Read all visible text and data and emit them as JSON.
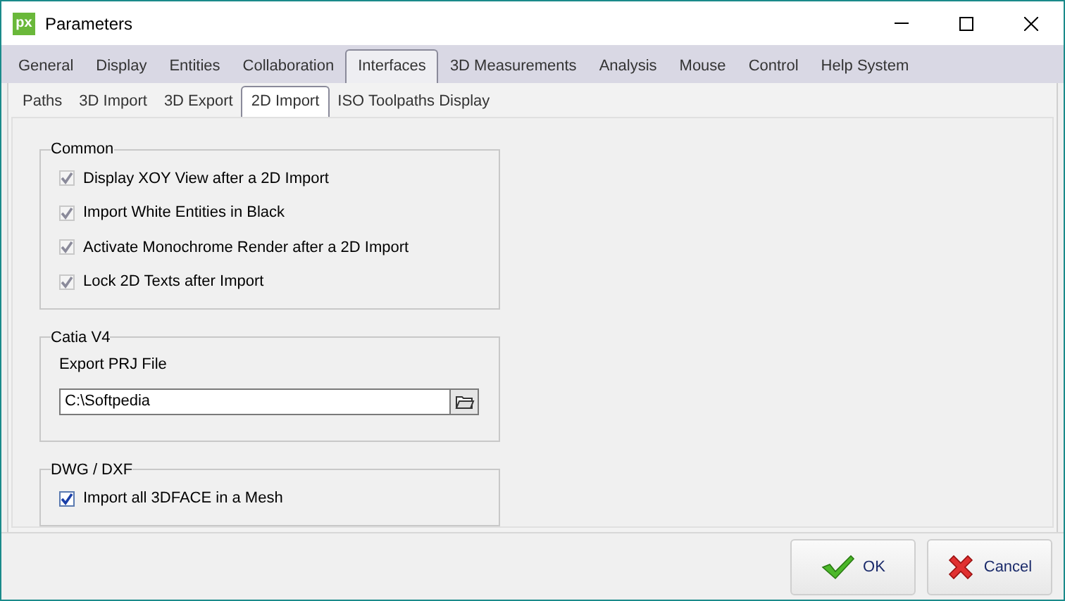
{
  "window": {
    "title": "Parameters",
    "logo": "px"
  },
  "tabs": [
    {
      "label": "General",
      "selected": false
    },
    {
      "label": "Display",
      "selected": false
    },
    {
      "label": "Entities",
      "selected": false
    },
    {
      "label": "Collaboration",
      "selected": false
    },
    {
      "label": "Interfaces",
      "selected": true
    },
    {
      "label": "3D Measurements",
      "selected": false
    },
    {
      "label": "Analysis",
      "selected": false
    },
    {
      "label": "Mouse",
      "selected": false
    },
    {
      "label": "Control",
      "selected": false
    },
    {
      "label": "Help System",
      "selected": false
    }
  ],
  "subtabs": [
    {
      "label": "Paths",
      "selected": false
    },
    {
      "label": "3D Import",
      "selected": false
    },
    {
      "label": "3D Export",
      "selected": false
    },
    {
      "label": "2D Import",
      "selected": true
    },
    {
      "label": "ISO Toolpaths Display",
      "selected": false
    }
  ],
  "groups": [
    {
      "title": "Common",
      "items": [
        {
          "kind": "checkbox",
          "label": "Display XOY View after a 2D Import",
          "checked": true,
          "disabled": true
        },
        {
          "kind": "checkbox",
          "label": "Import White Entities in Black",
          "checked": true,
          "disabled": true
        },
        {
          "kind": "checkbox",
          "label": "Activate Monochrome Render after a 2D Import",
          "checked": true,
          "disabled": true
        },
        {
          "kind": "checkbox",
          "label": "Lock 2D Texts after Import",
          "checked": true,
          "disabled": true
        }
      ]
    },
    {
      "title": "Catia V4",
      "items": [
        {
          "kind": "file",
          "label": "Export PRJ File",
          "value": "C:\\Softpedia"
        }
      ]
    },
    {
      "title": "DWG / DXF",
      "items": [
        {
          "kind": "checkbox",
          "label": "Import all 3DFACE in a Mesh",
          "checked": true,
          "disabled": false
        }
      ]
    }
  ],
  "buttons": [
    {
      "kind": "ok",
      "label": "OK"
    },
    {
      "kind": "cancel",
      "label": "Cancel"
    }
  ]
}
